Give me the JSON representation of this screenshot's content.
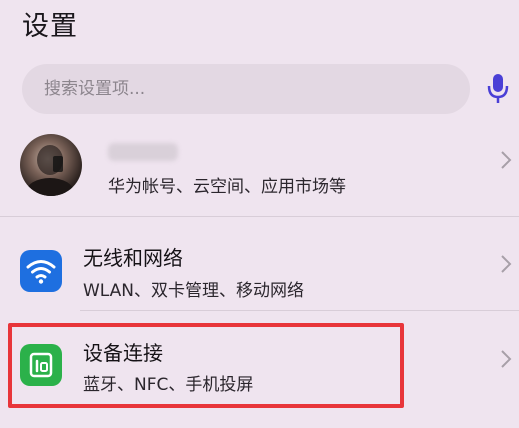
{
  "header": {
    "title": "设置"
  },
  "search": {
    "placeholder": "搜索设置项...",
    "mic_icon": "microphone-icon"
  },
  "account": {
    "avatar_icon": "avatar",
    "subtitle": "华为帐号、云空间、应用市场等"
  },
  "items": [
    {
      "title": "无线和网络",
      "subtitle": "WLAN、双卡管理、移动网络",
      "icon": "wifi-icon",
      "icon_color": "#1e6fe0"
    },
    {
      "title": "设备连接",
      "subtitle": "蓝牙、NFC、手机投屏",
      "icon": "device-connection-icon",
      "icon_color": "#2bb14a"
    }
  ],
  "colors": {
    "highlight": "#e8353a",
    "mic": "#4a3fd6",
    "background": "#efe4ef"
  }
}
